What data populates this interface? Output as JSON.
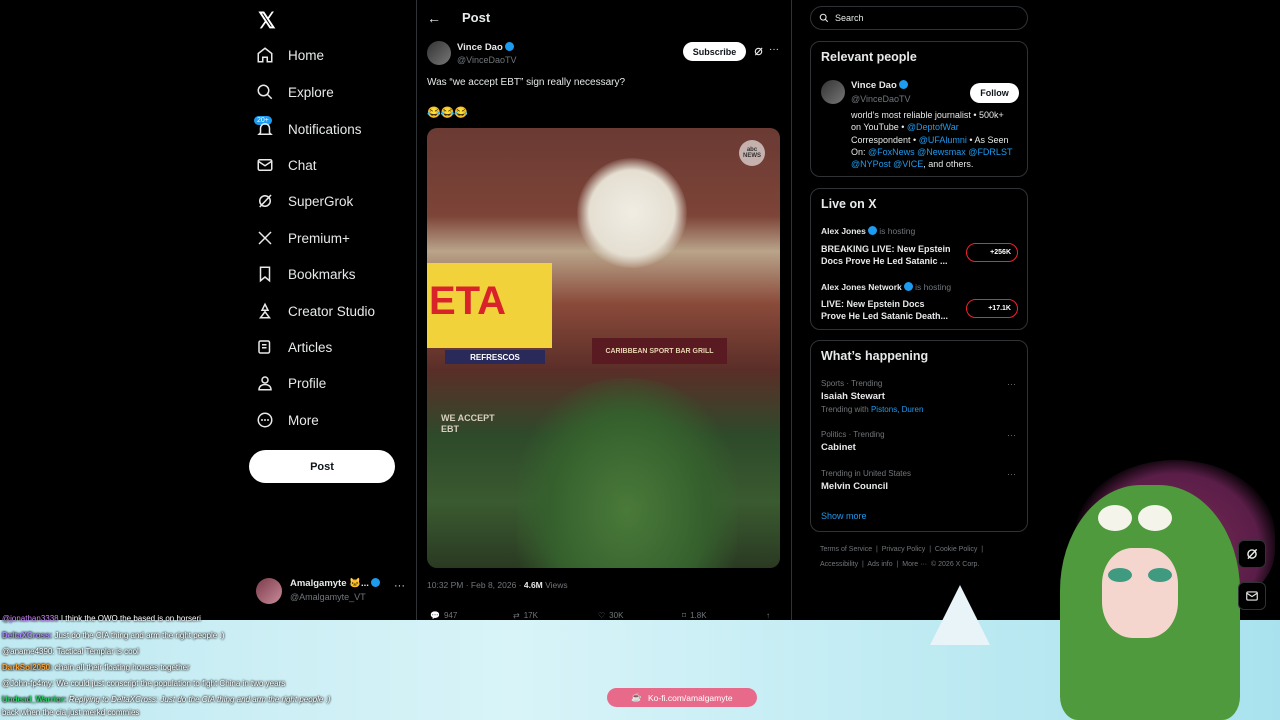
{
  "nav": {
    "items": [
      {
        "label": "Home",
        "icon": "home-icon"
      },
      {
        "label": "Explore",
        "icon": "search-icon"
      },
      {
        "label": "Notifications",
        "icon": "bell-icon"
      },
      {
        "label": "Chat",
        "icon": "chat-icon"
      },
      {
        "label": "SuperGrok",
        "icon": "grok-icon"
      },
      {
        "label": "Premium+",
        "icon": "x-icon"
      },
      {
        "label": "Bookmarks",
        "icon": "bookmark-icon"
      },
      {
        "label": "Creator Studio",
        "icon": "creator-icon"
      },
      {
        "label": "Articles",
        "icon": "articles-icon"
      },
      {
        "label": "Profile",
        "icon": "person-icon"
      },
      {
        "label": "More",
        "icon": "more-circle-icon"
      }
    ],
    "notification_badge": "20+",
    "post_button": "Post",
    "account": {
      "name": "Amalgamyte 🐱...",
      "handle": "@Amalgamyte_VT"
    }
  },
  "post": {
    "header_title": "Post",
    "author_name": "Vince Dao",
    "author_handle": "@VinceDaoTV",
    "subscribe_label": "Subscribe",
    "text": "Was “we accept EBT” sign really necessary?",
    "emojis": "😂😂😂",
    "media_watermark": "abc NEWS",
    "media_sign_main": "ETA",
    "media_sign_refrescos": "REFRESCOS",
    "media_sign_bar": "CARIBBEAN SPORT BAR GRILL",
    "media_sign_ebt": "WE ACCEPT EBT",
    "timestamp": "10:32 PM · Feb 8, 2026 · ",
    "views_count": "4.6M",
    "views_label": " Views",
    "stats": {
      "replies": "947",
      "reposts": "17K",
      "likes": "30K",
      "bookmarks": "1.8K"
    }
  },
  "search": {
    "placeholder": "Search"
  },
  "relevant": {
    "title": "Relevant people",
    "name": "Vince Dao",
    "handle": "@VinceDaoTV",
    "follow_label": "Follow",
    "bio_1": "world’s most reliable journalist • 500k+",
    "bio_2": "on YouTube • ",
    "bio_link_1": "@DeptofWar",
    "bio_3": "Correspondent • ",
    "bio_link_2": "@UFAlumni",
    "bio_4": " • As Seen",
    "bio_5": "On: ",
    "bio_link_3": "@FoxNews @Newsmax @FDRLST",
    "bio_link_4": "@NYPost @VICE",
    "bio_6": ", and others."
  },
  "live": {
    "title": "Live on X",
    "items": [
      {
        "host": "Alex Jones",
        "hosting": "is hosting",
        "title_1": "BREAKING LIVE: New Epstein",
        "title_2": "Docs Prove He Led Satanic ...",
        "count": "+256K"
      },
      {
        "host": "Alex Jones Network",
        "hosting": "is hosting",
        "title_1": "LIVE: New Epstein Docs",
        "title_2": "Prove He Led Satanic Death...",
        "count": "+17.1K"
      }
    ]
  },
  "happening": {
    "title": "What’s happening",
    "trends": [
      {
        "context": "Sports · Trending",
        "topic": "Isaiah Stewart",
        "extra_prefix": "Trending with ",
        "extra_links": "Pistons, Duren"
      },
      {
        "context": "Politics · Trending",
        "topic": "Cabinet"
      },
      {
        "context": "Trending in United States",
        "topic": "Melvin Council"
      }
    ],
    "show_more": "Show more"
  },
  "footer": {
    "line1": [
      "Terms of Service",
      "Privacy Policy",
      "Cookie Policy"
    ],
    "line2": [
      "Accessibility",
      "Ads info",
      "More ···",
      "© 2026 X Corp."
    ]
  },
  "chat": [
    {
      "user": "@jonathan3338",
      "msg": "I think the OWO the based is on horseri"
    },
    {
      "user": "DeltaXCross:",
      "msg": " Just do the CIA thing and arm the right people :)"
    },
    {
      "user": "@aname4390:",
      "msg": " Tactical Templar is cool"
    },
    {
      "user": "DarkSol2050:",
      "msg": " chain all their floating houses together"
    },
    {
      "user": "@John-fp4my:",
      "msg": " We could just conscript the population to fight China in two years"
    },
    {
      "user": "Undead_Warrior:",
      "msg": " Replying to DeltaXCross: Just do the CIA thing and arm the right people :)"
    },
    {
      "user": "",
      "msg": "back when the cia just merkd commies"
    }
  ],
  "kofi": "Ko-fi.com/amalgamyte",
  "colors": {
    "accent": "#1d9bf0",
    "live_red": "#f4212e",
    "kofi_pink": "#e86a8a"
  }
}
